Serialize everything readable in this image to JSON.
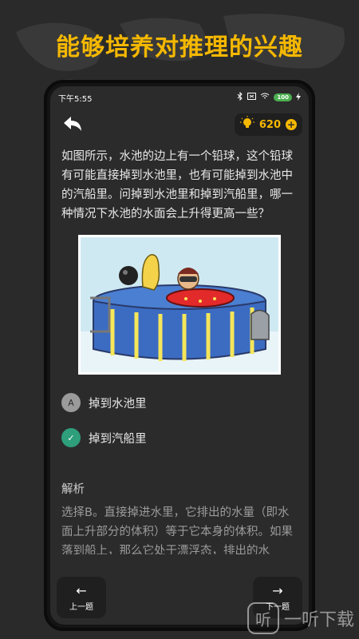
{
  "promo": {
    "title": "能够培养对推理的兴趣"
  },
  "status_bar": {
    "time": "下午5:55",
    "battery": "100"
  },
  "header": {
    "coins": "620",
    "plus_symbol": "+",
    "back_icon": "back-arrow-icon",
    "coin_icon": "lightbulb-icon"
  },
  "question": {
    "text": "如图所示，水池的边上有一个铅球，这个铅球有可能直接掉到水池里，也有可能掉到水池中的汽船里。问掉到水池里和掉到汽船里，哪一种情况下水池的水面会上升得更高一些？"
  },
  "options": [
    {
      "mark": "A",
      "label": "掉到水池里",
      "state": "neutral"
    },
    {
      "mark": "✓",
      "label": "掉到汽船里",
      "state": "correct"
    }
  ],
  "analysis": {
    "title": "解析",
    "text": "选择B。直接掉进水里，它排出的水量（即水面上升部分的体积）等于它本身的体积。如果落到船上，那么它处于漂浮态，排出的水"
  },
  "nav": {
    "prev_label": "上一题",
    "prev_arrow": "←",
    "next_label": "下一题",
    "next_arrow": "→"
  },
  "watermark": {
    "text": "一听下载"
  },
  "colors": {
    "accent": "#f5b800",
    "correct": "#2e9e7b",
    "background": "#2b2b2b"
  }
}
